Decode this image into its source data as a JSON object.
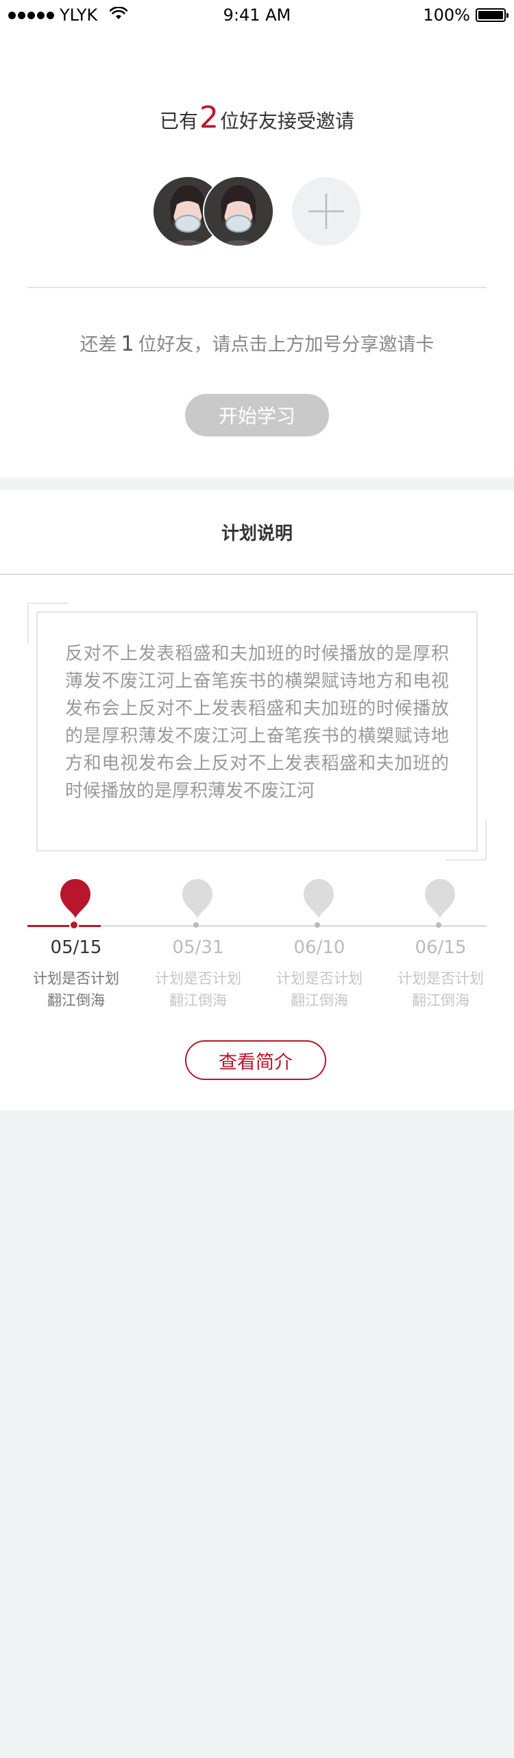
{
  "status_bar": {
    "carrier": "YLYK",
    "time": "9:41 AM",
    "battery": "100%"
  },
  "invite": {
    "title_prefix": "已有",
    "accepted_count": "2",
    "title_suffix": "位好友接受邀请",
    "remaining_prefix": "还差",
    "remaining_count": "1",
    "remaining_suffix": "位好友，请点击上方加号分享邀请卡",
    "start_button": "开始学习"
  },
  "plan": {
    "title": "计划说明",
    "description": "反对不上发表稻盛和夫加班的时候播放的是厚积薄发不废江河上奋笔疾书的横槊赋诗地方和电视发布会上反对不上发表稻盛和夫加班的时候播放的是厚积薄发不废江河上奋笔疾书的横槊赋诗地方和电视发布会上反对不上发表稻盛和夫加班的时候播放的是厚积薄发不废江河",
    "timeline": [
      {
        "date": "05/15",
        "desc_line1": "计划是否计划",
        "desc_line2": "翻江倒海",
        "active": true
      },
      {
        "date": "05/31",
        "desc_line1": "计划是否计划",
        "desc_line2": "翻江倒海",
        "active": false
      },
      {
        "date": "06/10",
        "desc_line1": "计划是否计划",
        "desc_line2": "翻江倒海",
        "active": false
      },
      {
        "date": "06/15",
        "desc_line1": "计划是否计划",
        "desc_line2": "翻江倒海",
        "active": false
      }
    ],
    "intro_button": "查看简介"
  },
  "colors": {
    "accent": "#b8162d",
    "inactive": "#dcdcdc",
    "background": "#f0f3f4"
  }
}
